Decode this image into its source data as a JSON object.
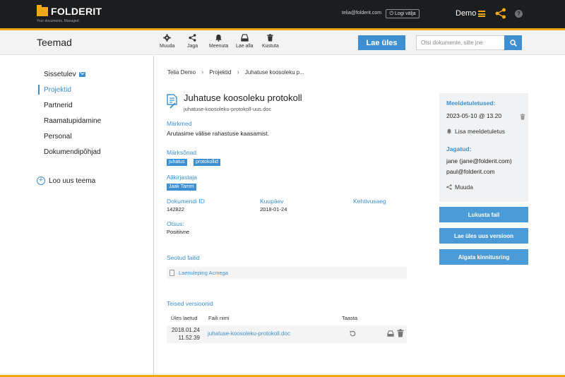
{
  "header": {
    "brand": "FOLDERIT",
    "tagline": "Your documents. Managed.",
    "user_email": "telia@folderit.com",
    "logout_label": "Logi välja",
    "account_name": "Demo"
  },
  "toolbar": {
    "title": "Teemad",
    "actions": [
      {
        "label": "Muuda",
        "icon": "gear-icon"
      },
      {
        "label": "Jaga",
        "icon": "share-icon"
      },
      {
        "label": "Meenuta",
        "icon": "bell-icon"
      },
      {
        "label": "Lae alla",
        "icon": "download-icon"
      },
      {
        "label": "Kustuta",
        "icon": "trash-icon"
      }
    ],
    "upload_label": "Lae üles",
    "search_placeholder": "Otsi dokumente, silte jne"
  },
  "sidebar": {
    "items": [
      {
        "label": "Sissetulev"
      },
      {
        "label": "Projektid"
      },
      {
        "label": "Partnerid"
      },
      {
        "label": "Raamatupidamine"
      },
      {
        "label": "Personal"
      },
      {
        "label": "Dokumendipõhjad"
      }
    ],
    "new_topic_label": "Loo uus teema"
  },
  "breadcrumb": [
    "Telia Demo",
    "Projektid",
    "Juhatuse koosoleku p..."
  ],
  "document": {
    "title": "Juhatuse koosoleku protokoll",
    "filename": "juhatuse-koosoleku-protokoll-uus.doc",
    "notes_label": "Märkmed",
    "notes_value": "Arutasime välise rahastuse kaasamist.",
    "keywords_label": "Märksõnad",
    "keywords": [
      "juhatus",
      "protokollid"
    ],
    "signer_label": "Allkirjastaja",
    "signer": "Jaak Tamm",
    "doc_id_label": "Dokumendi ID",
    "doc_id": "142822",
    "date_label": "Kuupäev",
    "date": "2018-01-24",
    "validity_label": "Kehtivusaeg",
    "decision_label": "Otsus:",
    "decision": "Positiivne",
    "linked_files_label": "Seotud failid",
    "linked_files": [
      "Laenuleping Acmega"
    ],
    "versions_label": "Teised versioonid",
    "versions_headers": {
      "uploaded": "Üles laetud",
      "filename": "Faili nimi",
      "restore": "Taasta"
    },
    "versions": [
      {
        "date": "2018.01.24",
        "time": "11.52.39",
        "filename": "juhatuse-koosoleku-protokoll.doc"
      }
    ]
  },
  "info_panel": {
    "reminders_label": "Meeldetuletused:",
    "reminder": "2023-05-10 @ 13.20",
    "add_reminder_label": "Lisa meeldetuletus",
    "shared_label": "Jagatud:",
    "shared_with": [
      "jane (jane@folderit.com)",
      "paul@folderit.com"
    ],
    "edit_share_label": "Muuda"
  },
  "side_buttons": {
    "lock": "Lukusta fail",
    "upload_version": "Lae üles uus versioon",
    "start_signing": "Algata kinnitusring"
  },
  "colors": {
    "accent": "#3d8fd1",
    "brand_yellow": "#f2a917",
    "topbar": "#1b1d1f"
  }
}
